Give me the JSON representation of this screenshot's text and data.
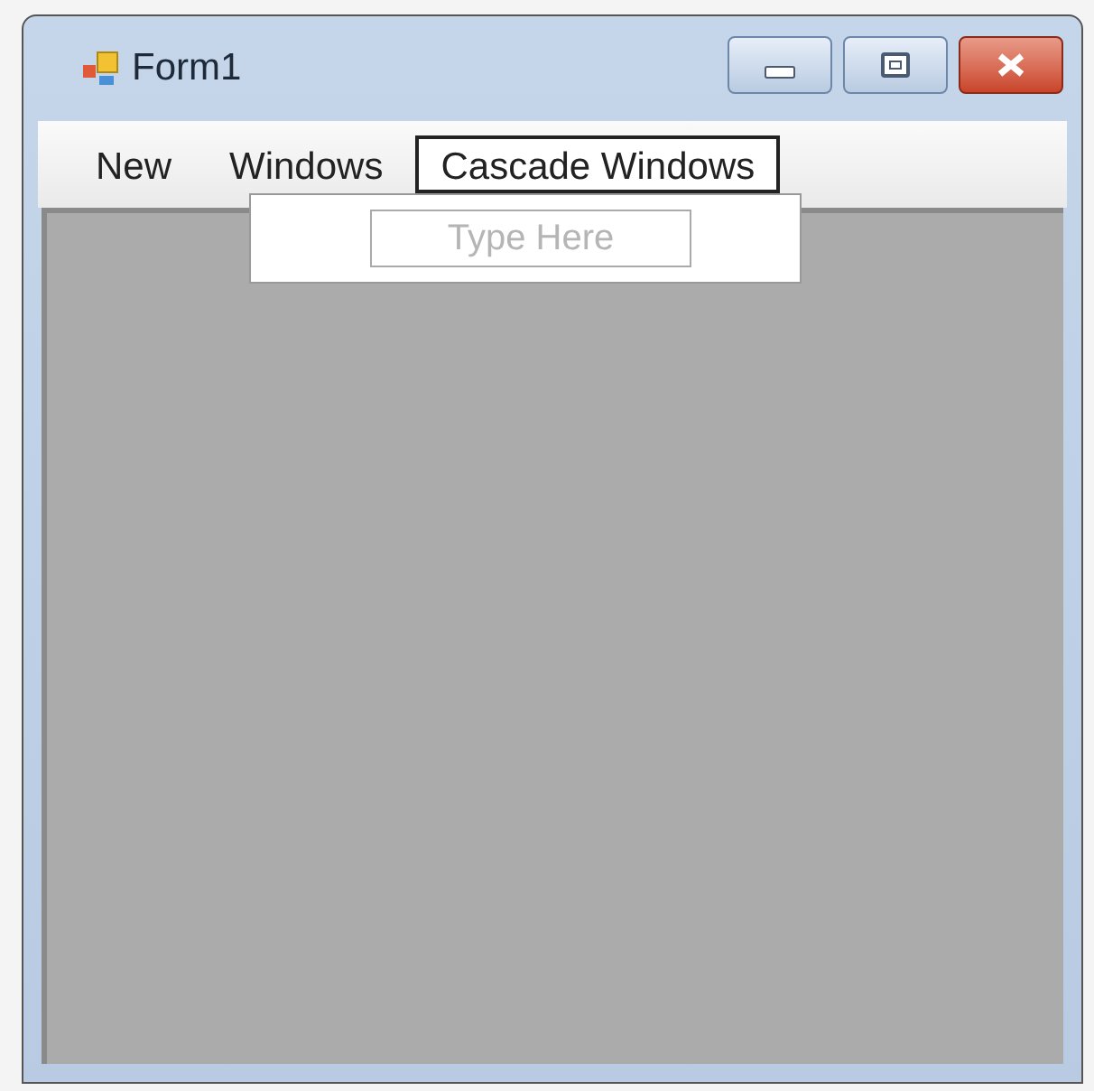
{
  "window": {
    "title": "Form1"
  },
  "menu": [
    {
      "label": "New",
      "selected": false
    },
    {
      "label": "Windows",
      "selected": false
    },
    {
      "label": "Cascade Windows",
      "selected": true,
      "dropdown": {
        "placeholder": "Type Here"
      }
    }
  ]
}
